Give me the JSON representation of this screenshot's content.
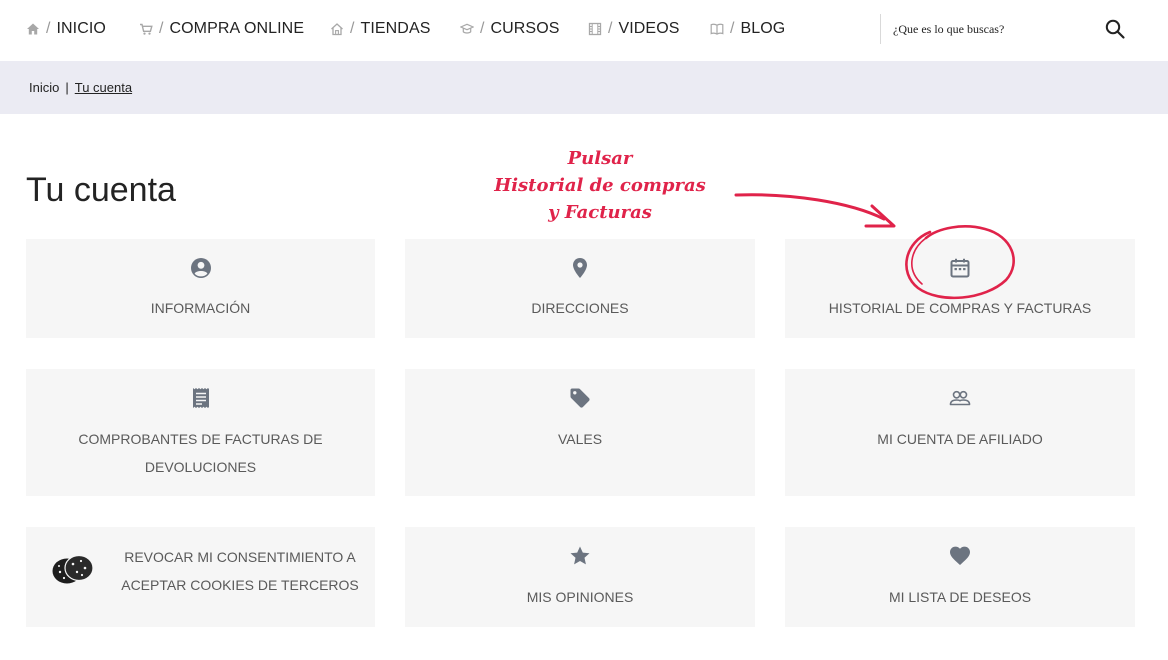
{
  "nav": {
    "items": [
      {
        "label": "INICIO",
        "icon": "home-icon"
      },
      {
        "label": "COMPRA ONLINE",
        "icon": "cart-icon"
      },
      {
        "label": "TIENDAS",
        "icon": "store-icon"
      },
      {
        "label": "CURSOS",
        "icon": "graduation-cap-icon"
      },
      {
        "label": "VIDEOS",
        "icon": "film-icon"
      },
      {
        "label": "BLOG",
        "icon": "book-icon"
      }
    ],
    "separator": "/",
    "search_placeholder": "¿Que es lo que buscas?"
  },
  "breadcrumb": {
    "home": "Inicio",
    "separator": "|",
    "current": "Tu cuenta"
  },
  "page": {
    "title": "Tu cuenta"
  },
  "annotation": {
    "line1": "Pulsar",
    "line2": "Historial de compras",
    "line3": "y Facturas",
    "color": "#e0234a"
  },
  "tiles": [
    {
      "label": "INFORMACIÓN",
      "icon": "account-circle-icon"
    },
    {
      "label": "DIRECCIONES",
      "icon": "location-pin-icon"
    },
    {
      "label": "HISTORIAL DE COMPRAS Y FACTURAS",
      "icon": "calendar-icon"
    },
    {
      "label": "COMPROBANTES DE FACTURAS DE DEVOLUCIONES",
      "icon": "receipt-icon"
    },
    {
      "label": "VALES",
      "icon": "tag-icon"
    },
    {
      "label": "MI CUENTA DE AFILIADO",
      "icon": "group-icon"
    },
    {
      "label": "REVOCAR MI CONSENTIMIENTO A ACEPTAR COOKIES DE TERCEROS",
      "icon": "cookie-icon"
    },
    {
      "label": "MIS OPINIONES",
      "icon": "star-icon"
    },
    {
      "label": "MI LISTA DE DESEOS",
      "icon": "heart-icon"
    }
  ],
  "colors": {
    "tile_bg": "#f6f6f6",
    "breadcrumb_bg": "#ebebf3",
    "icon_gray": "#6c7480",
    "text_gray": "#5a5a5a"
  }
}
